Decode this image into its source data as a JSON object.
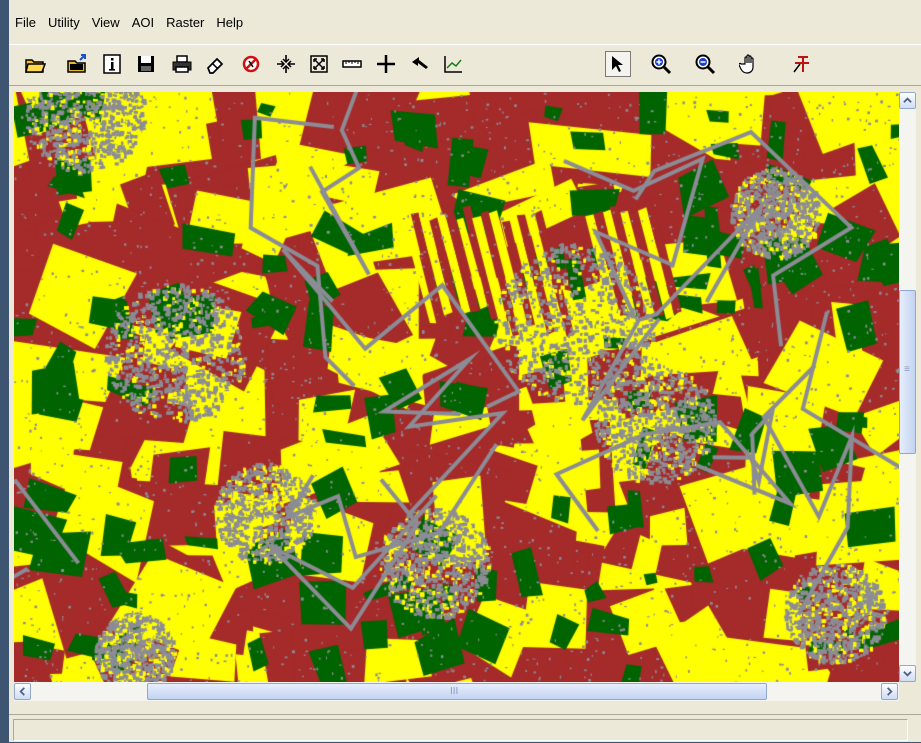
{
  "menu": {
    "items": [
      "File",
      "Utility",
      "View",
      "AOI",
      "Raster",
      "Help"
    ]
  },
  "toolbar": {
    "icons": [
      "open-folder-icon",
      "open-layer-icon",
      "info-icon",
      "save-icon",
      "print-icon",
      "eraser-icon",
      "no-entry-icon",
      "zoom-to-fit-icon",
      "fit-window-icon",
      "ruler-icon",
      "crosshair-icon",
      "arrow-icon",
      "profile-chart-icon",
      "select-pointer-icon",
      "zoom-in-icon",
      "zoom-out-icon",
      "pan-hand-icon",
      "inquire-cursor-icon"
    ],
    "active_tool": "select-pointer-icon"
  },
  "map": {
    "class_colors": {
      "yellow": "#ffff00",
      "red": "#a52a2a",
      "green": "#006400",
      "gray": "#8c8c96"
    }
  },
  "scrollbars": {
    "horizontal_grip": "III",
    "vertical_grip": "≡"
  },
  "status": {
    "text": ""
  }
}
